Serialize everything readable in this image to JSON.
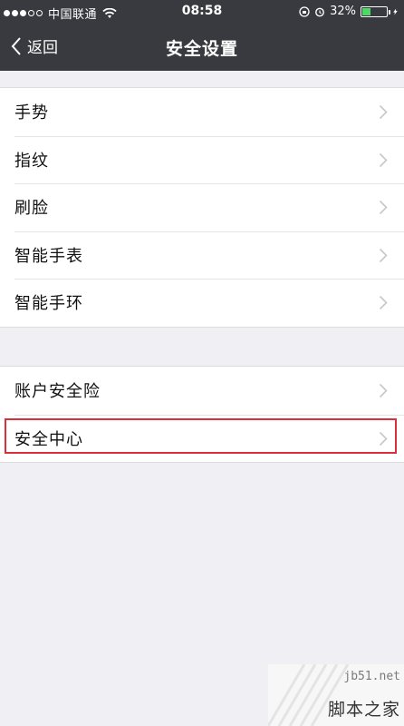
{
  "status_bar": {
    "carrier": "中国联通",
    "time": "08:58",
    "battery_percent": "32%",
    "battery_level": 0.32,
    "battery_color": "#4cd964",
    "icons": [
      "signal-dots-icon",
      "wifi-icon",
      "rotation-lock-icon",
      "alarm-icon",
      "battery-icon",
      "charging-icon"
    ]
  },
  "nav": {
    "back_label": "返回",
    "title": "安全设置",
    "background": "#393a3f"
  },
  "groups": [
    {
      "items": [
        {
          "label": "手势"
        },
        {
          "label": "指纹"
        },
        {
          "label": "刷脸"
        },
        {
          "label": "智能手表"
        },
        {
          "label": "智能手环"
        }
      ]
    },
    {
      "items": [
        {
          "label": "账户安全险"
        },
        {
          "label": "安全中心"
        }
      ]
    }
  ],
  "highlight_color": "#d9303a",
  "watermark": {
    "site": "jb51.net",
    "name": "脚本之家"
  }
}
